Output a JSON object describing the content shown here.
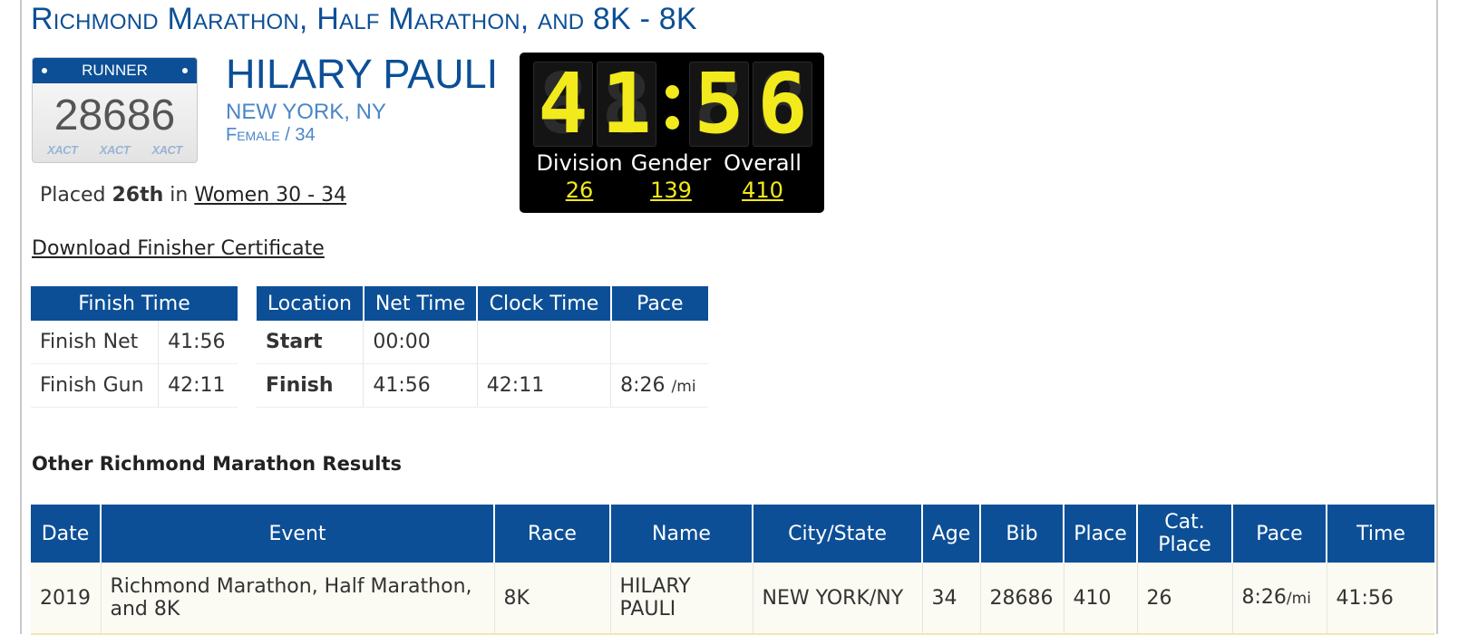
{
  "event_title": "Richmond Marathon, Half Marathon, and 8K - 8K",
  "bib": {
    "header": "RUNNER",
    "number": "28686",
    "brand": [
      "XACT",
      "XACT",
      "XACT"
    ]
  },
  "runner": {
    "name": "HILARY PAULI",
    "city": "NEW YORK, NY",
    "gender_age": "Female / 34"
  },
  "placement": {
    "prefix": "Placed",
    "place": "26th",
    "mid": "in",
    "division": "Women 30 - 34"
  },
  "scoreboard": {
    "time_digits": [
      "4",
      "1",
      "5",
      "6"
    ],
    "labels": [
      "Division",
      "Gender",
      "Overall"
    ],
    "values": [
      "26",
      "139",
      "410"
    ],
    "colors": {
      "digit": "#f2ea1c",
      "background": "#000000"
    }
  },
  "certificate_link": "Download Finisher Certificate",
  "finish_time_table": {
    "header": "Finish Time",
    "rows": [
      [
        "Finish Net",
        "41:56"
      ],
      [
        "Finish Gun",
        "42:11"
      ]
    ]
  },
  "splits_table": {
    "headers": [
      "Location",
      "Net Time",
      "Clock Time",
      "Pace"
    ],
    "rows": [
      {
        "location": "Start",
        "net": "00:00",
        "clock": "",
        "pace": "",
        "pace_unit": ""
      },
      {
        "location": "Finish",
        "net": "41:56",
        "clock": "42:11",
        "pace": "8:26",
        "pace_unit": "/mi"
      }
    ]
  },
  "other_results": {
    "title": "Other Richmond Marathon Results",
    "headers": [
      "Date",
      "Event",
      "Race",
      "Name",
      "City/State",
      "Age",
      "Bib",
      "Place",
      "Cat. Place",
      "Pace",
      "Time"
    ],
    "rows": [
      {
        "date": "2019",
        "event": "Richmond Marathon, Half Marathon, and 8K",
        "race": "8K",
        "name": "HILARY PAULI",
        "city_state": "NEW YORK/NY",
        "age": "34",
        "bib": "28686",
        "place": "410",
        "cat_place": "26",
        "pace": "8:26",
        "pace_unit": "/mi",
        "time": "41:56"
      }
    ]
  },
  "colors": {
    "brand_blue": "#0c4f96",
    "light_blue": "#4a86c8"
  }
}
